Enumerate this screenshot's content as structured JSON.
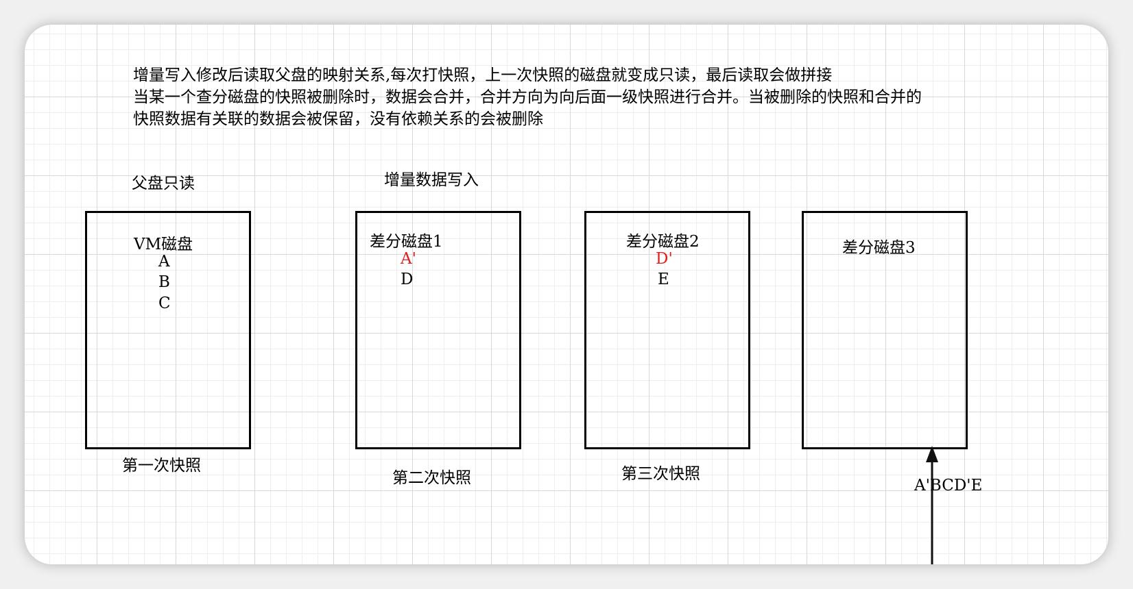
{
  "description": {
    "line1": "增量写入修改后读取父盘的映射关系,每次打快照，上一次快照的磁盘就变成只读，最后读取会做拼接",
    "line2": "当某一个查分磁盘的快照被删除时，数据会合并，合并方向为向后面一级快照进行合并。当被删除的快照和合并的",
    "line3": "快照数据有关联的数据会被保留，没有依赖关系的会被删除"
  },
  "top_labels": {
    "parent_readonly": "父盘只读",
    "incremental_write": "增量数据写入"
  },
  "boxes": [
    {
      "title": "VM磁盘",
      "items": [
        "A",
        "B",
        "C"
      ],
      "item_colors": [
        "#000000",
        "#000000",
        "#000000"
      ]
    },
    {
      "title": "差分磁盘1",
      "items": [
        "A'",
        "D"
      ],
      "item_colors": [
        "#e02020",
        "#000000"
      ]
    },
    {
      "title": "差分磁盘2",
      "items": [
        "D'",
        "E"
      ],
      "item_colors": [
        "#e02020",
        "#000000"
      ]
    },
    {
      "title": "差分磁盘3",
      "items": [],
      "item_colors": []
    }
  ],
  "bottom_labels": {
    "snapshot1": "第一次快照",
    "snapshot2": "第二次快照",
    "snapshot3": "第三次快照",
    "merged": "A'BCD'E"
  },
  "colors": {
    "accent_red": "#e02020",
    "stroke": "#000000"
  }
}
